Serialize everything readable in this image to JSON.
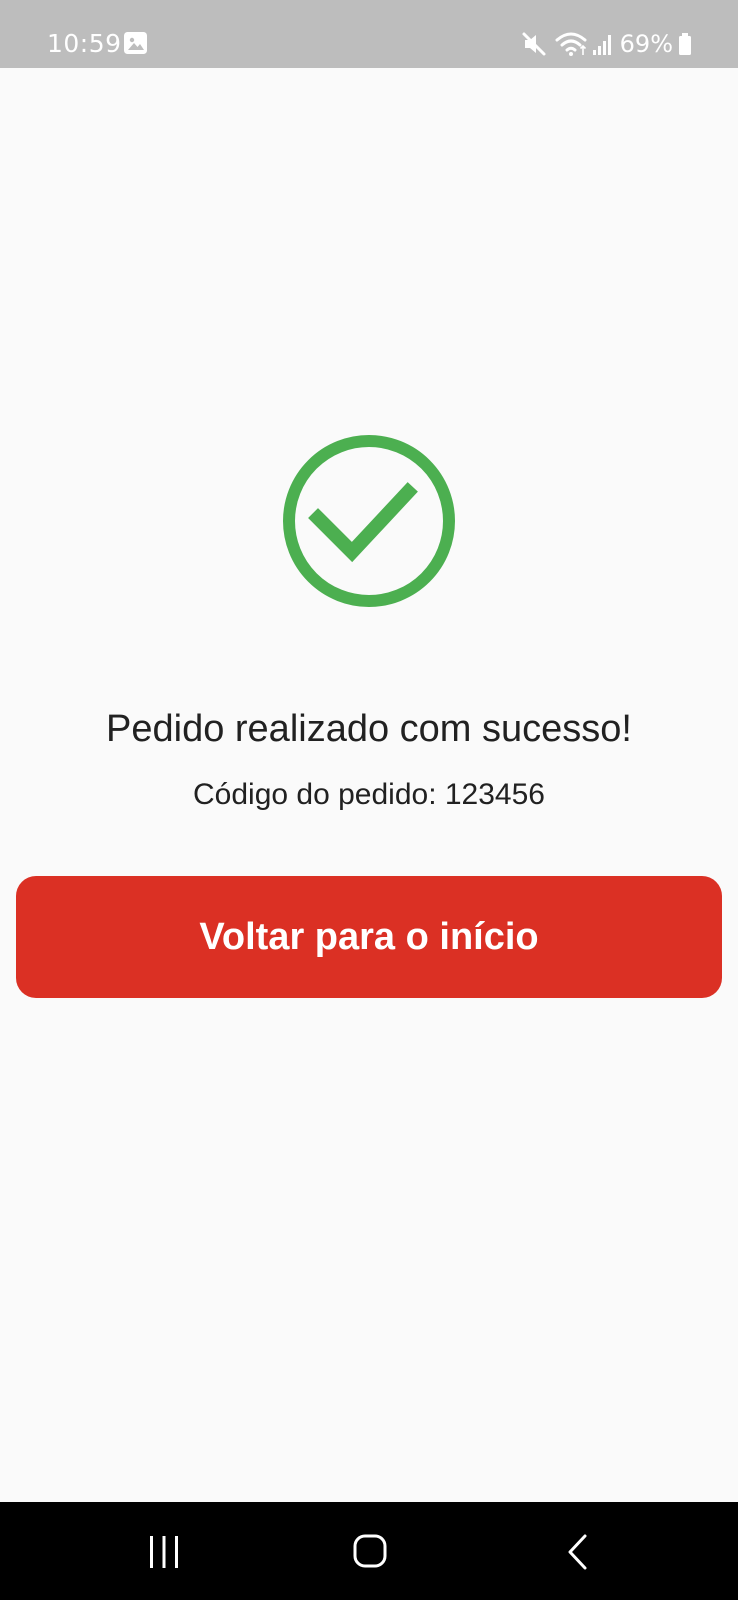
{
  "status_bar": {
    "time": "10:59",
    "battery_percent": "69%",
    "icons": [
      "gallery-icon",
      "mute-icon",
      "wifi-icon",
      "signal-icon",
      "battery-icon"
    ]
  },
  "success": {
    "icon": "check-circle-icon",
    "title": "Pedido realizado com sucesso!",
    "order_code": "Código do pedido: 123456"
  },
  "actions": {
    "back_home_label": "Voltar para o início"
  },
  "nav_bar": {
    "icons": [
      "recent-apps-icon",
      "home-icon",
      "back-icon"
    ]
  },
  "colors": {
    "status_bar_bg": "#bdbdbd",
    "page_bg": "#fafafa",
    "success_green": "#4caf50",
    "button_red": "#db3024",
    "nav_bar_bg": "#000000"
  }
}
